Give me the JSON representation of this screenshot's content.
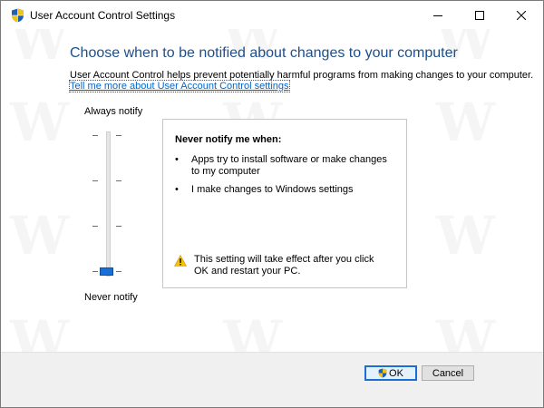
{
  "window": {
    "title": "User Account Control Settings",
    "icon": "uac-shield-icon"
  },
  "content": {
    "heading": "Choose when to be notified about changes to your computer",
    "description": "User Account Control helps prevent potentially harmful programs from making changes to your computer.",
    "learn_more_link": "Tell me more about User Account Control settings"
  },
  "slider": {
    "top_label": "Always notify",
    "bottom_label": "Never notify",
    "levels": 4,
    "selected_level": 1,
    "accent_color": "#1a6fd6"
  },
  "info": {
    "title": "Never notify me when:",
    "bullets": [
      "Apps try to install software or make changes to my computer",
      "I make changes to Windows settings"
    ],
    "warning_icon": "warning-triangle-icon",
    "warning": "This setting will take effect after you click OK and restart your PC."
  },
  "buttons": {
    "ok": "OK",
    "cancel": "Cancel"
  },
  "colors": {
    "heading": "#1e4e8c",
    "link": "#0066cc"
  }
}
